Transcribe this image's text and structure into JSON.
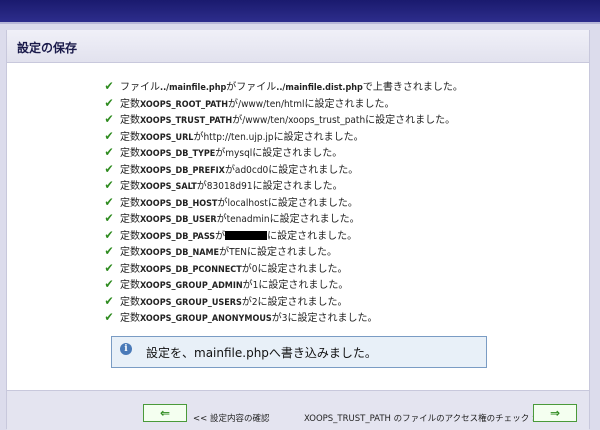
{
  "panel": {
    "title": "設定の保存"
  },
  "results": [
    {
      "pre": "ファイル",
      "const": "../mainfile.php",
      "mid": "がファイル",
      "const2": "../mainfile.dist.php",
      "post": "で上書きされました。"
    },
    {
      "pre": "定数",
      "const": "XOOPS_ROOT_PATH",
      "post": "が/www/ten/htmlに設定されました。"
    },
    {
      "pre": "定数",
      "const": "XOOPS_TRUST_PATH",
      "post": "が/www/ten/xoops_trust_pathに設定されました。"
    },
    {
      "pre": "定数",
      "const": "XOOPS_URL",
      "post": "がhttp://ten.ujp.jpに設定されました。"
    },
    {
      "pre": "定数",
      "const": "XOOPS_DB_TYPE",
      "post": "がmysqlに設定されました。"
    },
    {
      "pre": "定数",
      "const": "XOOPS_DB_PREFIX",
      "post": "がad0cd0に設定されました。"
    },
    {
      "pre": "定数",
      "const": "XOOPS_SALT",
      "post": "が83018d91に設定されました。"
    },
    {
      "pre": "定数",
      "const": "XOOPS_DB_HOST",
      "post": "がlocalhostに設定されました。"
    },
    {
      "pre": "定数",
      "const": "XOOPS_DB_USER",
      "post": "がtenadminに設定されました。"
    },
    {
      "pre": "定数",
      "const": "XOOPS_DB_PASS",
      "post": "がに設定されました。",
      "redacted": true
    },
    {
      "pre": "定数",
      "const": "XOOPS_DB_NAME",
      "post": "がTENに設定されました。"
    },
    {
      "pre": "定数",
      "const": "XOOPS_DB_PCONNECT",
      "post": "が0に設定されました。"
    },
    {
      "pre": "定数",
      "const": "XOOPS_GROUP_ADMIN",
      "post": "が1に設定されました。"
    },
    {
      "pre": "定数",
      "const": "XOOPS_GROUP_USERS",
      "post": "が2に設定されました。"
    },
    {
      "pre": "定数",
      "const": "XOOPS_GROUP_ANONYMOUS",
      "post": "が3に設定されました。"
    }
  ],
  "info": {
    "message": "設定を、mainfile.phpへ書き込みました。"
  },
  "nav": {
    "back_button": "⇐",
    "back_label": "<< 設定内容の確認",
    "next_label": "XOOPS_TRUST_PATH のファイルのアクセス権のチェック >>",
    "next_button": "⇒"
  },
  "colors": {
    "header": "#1a1a6e",
    "check": "#2e8b1f",
    "info_border": "#7a9cc4"
  },
  "icons": {
    "result": "check-icon",
    "info": "info-icon"
  }
}
